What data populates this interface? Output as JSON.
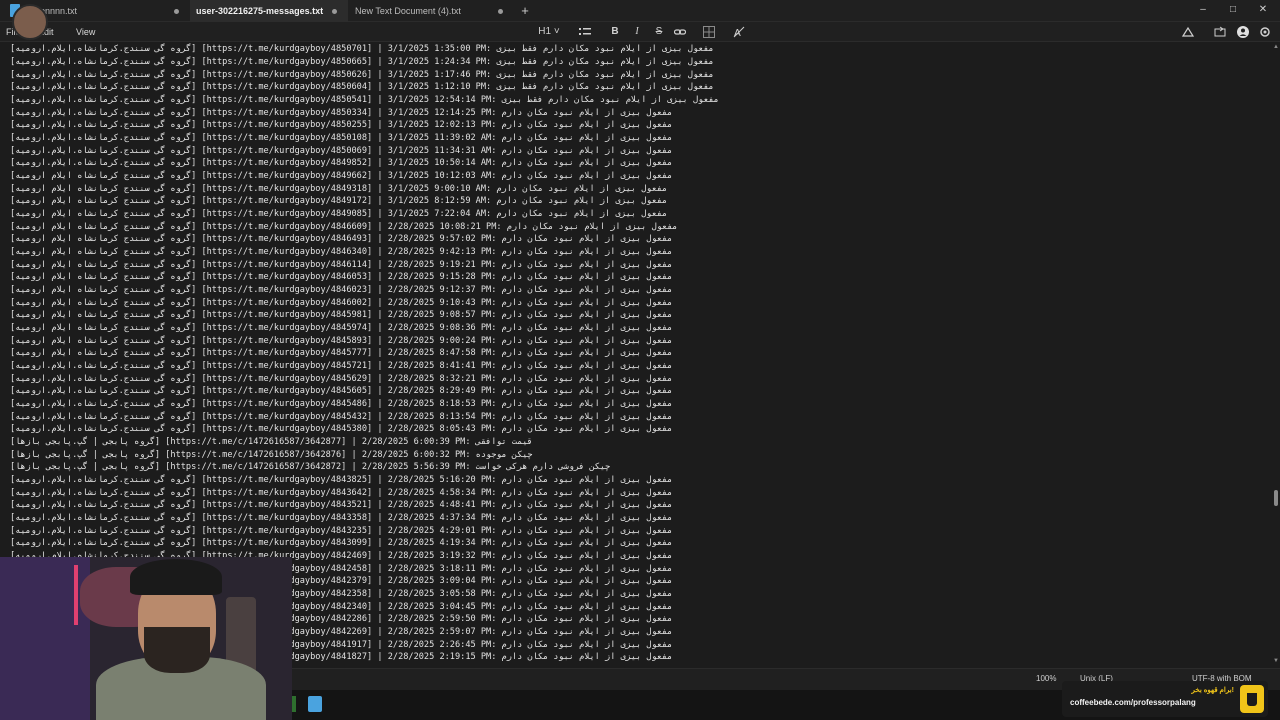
{
  "tabs": [
    {
      "label": "onnnn.txt",
      "active": false
    },
    {
      "label": "user-302216275-messages.txt",
      "active": true
    },
    {
      "label": "New Text Document (4).txt",
      "active": false
    }
  ],
  "menu": {
    "file": "File",
    "edit": "Edit",
    "view": "View"
  },
  "toolbar": {
    "heading": "H1",
    "bold": "B",
    "italic": "I",
    "strike": "S"
  },
  "lines": [
    "[گروه گی سنندج.کرمانشاه.ایلام.ارومیه] [https://t.me/kurdgayboy/4850701] | 3/1/2025 1:35:00 PM: مفعول بیزی از ایلام نبود مکان دارم فقط بیزی",
    "[گروه گی سنندج.کرمانشاه.ایلام.ارومیه] [https://t.me/kurdgayboy/4850665] | 3/1/2025 1:24:34 PM: مفعول بیزی از ایلام نبود مکان دارم فقط بیزی",
    "[گروه گی سنندج.کرمانشاه.ایلام.ارومیه] [https://t.me/kurdgayboy/4850626] | 3/1/2025 1:17:46 PM: مفعول بیزی از ایلام نبود مکان دارم فقط بیزی",
    "[گروه گی سنندج.کرمانشاه.ایلام.ارومیه] [https://t.me/kurdgayboy/4850604] | 3/1/2025 1:12:10 PM: مفعول بیزی از ایلام نبود مکان دارم فقط بیزی",
    "[گروه گی سنندج.کرمانشاه.ایلام.ارومیه] [https://t.me/kurdgayboy/4850541] | 3/1/2025 12:54:14 PM: مفعول بیزی از ایلام نبود مکان دارم فقط بیزی",
    "[گروه گی سنندج.کرمانشاه.ایلام.ارومیه] [https://t.me/kurdgayboy/4850334] | 3/1/2025 12:14:25 PM: مفعول بیزی از ایلام نبود مکان دارم",
    "[گروه گی سنندج.کرمانشاه.ایلام.ارومیه] [https://t.me/kurdgayboy/4850255] | 3/1/2025 12:02:13 PM: مفعول بیزی از ایلام نبود مکان دارم",
    "[گروه گی سنندج.کرمانشاه.ایلام.ارومیه] [https://t.me/kurdgayboy/4850108] | 3/1/2025 11:39:02 AM: مفعول بیزی از ایلام نبود مکان دارم",
    "[گروه گی سنندج.کرمانشاه.ایلام.ارومیه] [https://t.me/kurdgayboy/4850069] | 3/1/2025 11:34:31 AM: مفعول بیزی از ایلام نبود مکان دارم",
    "[گروه گی سنندج.کرمانشاه.ایلام.ارومیه] [https://t.me/kurdgayboy/4849852] | 3/1/2025 10:50:14 AM: مفعول بیزی از ایلام نبود مکان دارم",
    "[گروه گی سنندج کرمانشاه ایلام ارومیه] [https://t.me/kurdgayboy/4849662] | 3/1/2025 10:12:03 AM: مفعول بیزی از ایلام نبود مکان دارم",
    "[گروه گی سنندج کرمانشاه ایلام ارومیه] [https://t.me/kurdgayboy/4849318] | 3/1/2025 9:00:10 AM: مفعول بیزی از ایلام نبود مکان دارم",
    "[گروه گی سنندج کرمانشاه ایلام ارومیه] [https://t.me/kurdgayboy/4849172] | 3/1/2025 8:12:59 AM: مفعول بیزی از ایلام نبود مکان دارم",
    "[گروه گی سنندج کرمانشاه ایلام ارومیه] [https://t.me/kurdgayboy/4849085] | 3/1/2025 7:22:04 AM: مفعول بیزی از ایلام نبود مکان دارم",
    "[گروه گی سنندج کرمانشاه ایلام ارومیه] [https://t.me/kurdgayboy/4846609] | 2/28/2025 10:08:21 PM: مفعول بیزی از ایلام نبود مکان دارم",
    "[گروه گی سنندج کرمانشاه ایلام ارومیه] [https://t.me/kurdgayboy/4846493] | 2/28/2025 9:57:02 PM: مفعول بیزی از ایلام نبود مکان دارم",
    "[گروه گی سنندج کرمانشاه ایلام ارومیه] [https://t.me/kurdgayboy/4846340] | 2/28/2025 9:42:13 PM: مفعول بیزی از ایلام نبود مکان دارم",
    "[گروه گی سنندج کرمانشاه ایلام ارومیه] [https://t.me/kurdgayboy/4846114] | 2/28/2025 9:19:21 PM: مفعول بیزی از ایلام نبود مکان دارم",
    "[گروه گی سنندج کرمانشاه ایلام ارومیه] [https://t.me/kurdgayboy/4846053] | 2/28/2025 9:15:28 PM: مفعول بیزی از ایلام نبود مکان دارم",
    "[گروه گی سنندج کرمانشاه ایلام ارومیه] [https://t.me/kurdgayboy/4846023] | 2/28/2025 9:12:37 PM: مفعول بیزی از ایلام نبود مکان دارم",
    "[گروه گی سنندج کرمانشاه ایلام ارومیه] [https://t.me/kurdgayboy/4846002] | 2/28/2025 9:10:43 PM: مفعول بیزی از ایلام نبود مکان دارم",
    "[گروه گی سنندج کرمانشاه ایلام ارومیه] [https://t.me/kurdgayboy/4845981] | 2/28/2025 9:08:57 PM: مفعول بیزی از ایلام نبود مکان دارم",
    "[گروه گی سنندج کرمانشاه ایلام ارومیه] [https://t.me/kurdgayboy/4845974] | 2/28/2025 9:08:36 PM: مفعول بیزی از ایلام نبود مکان دارم",
    "[گروه گی سنندج کرمانشاه ایلام ارومیه] [https://t.me/kurdgayboy/4845893] | 2/28/2025 9:00:24 PM: مفعول بیزی از ایلام نبود مکان دارم",
    "[گروه گی سنندج کرمانشاه ایلام ارومیه] [https://t.me/kurdgayboy/4845777] | 2/28/2025 8:47:58 PM: مفعول بیزی از ایلام نبود مکان دارم",
    "[گروه گی سنندج.کرمانشاه.ایلام.ارومیه] [https://t.me/kurdgayboy/4845721] | 2/28/2025 8:41:41 PM: مفعول بیزی از ایلام نبود مکان دارم",
    "[گروه گی سنندج.کرمانشاه.ایلام.ارومیه] [https://t.me/kurdgayboy/4845629] | 2/28/2025 8:32:21 PM: مفعول بیزی از ایلام نبود مکان دارم",
    "[گروه گی سنندج.کرمانشاه.ایلام.ارومیه] [https://t.me/kurdgayboy/4845605] | 2/28/2025 8:29:49 PM: مفعول بیزی از ایلام نبود مکان دارم",
    "[گروه گی سنندج.کرمانشاه.ایلام.ارومیه] [https://t.me/kurdgayboy/4845486] | 2/28/2025 8:18:53 PM: مفعول بیزی از ایلام نبود مکان دارم",
    "[گروه گی سنندج.کرمانشاه.ایلام.ارومیه] [https://t.me/kurdgayboy/4845432] | 2/28/2025 8:13:54 PM: مفعول بیزی از ایلام نبود مکان دارم",
    "[گروه گی سنندج.کرمانشاه.ایلام.ارومیه] [https://t.me/kurdgayboy/4845380] | 2/28/2025 8:05:43 PM: مفعول بیزی از ایلام نبود مکان دارم",
    "[گروه پابجی | گپ.پابجی بازها] [https://t.me/c/1472616587/3642877] | 2/28/2025 6:00:39 PM: قیمت توافقی",
    "[گروه پابجی | گپ.پابجی بازها] [https://t.me/c/1472616587/3642876] | 2/28/2025 6:00:32 PM: چیکن موجوده",
    "[گروه پابجی | گپ.پابجی بازها] [https://t.me/c/1472616587/3642872] | 2/28/2025 5:56:39 PM: چیکن فروشی دارم هرکی خواست",
    "[گروه گی سنندج.کرمانشاه.ایلام.ارومیه] [https://t.me/kurdgayboy/4843825] | 2/28/2025 5:16:20 PM: مفعول بیزی از ایلام نبود مکان دارم",
    "[گروه گی سنندج.کرمانشاه.ایلام.ارومیه] [https://t.me/kurdgayboy/4843642] | 2/28/2025 4:58:34 PM: مفعول بیزی از ایلام نبود مکان دارم",
    "[گروه گی سنندج.کرمانشاه.ایلام.ارومیه] [https://t.me/kurdgayboy/4843521] | 2/28/2025 4:48:41 PM: مفعول بیزی از ایلام نبود مکان دارم",
    "[گروه گی سنندج.کرمانشاه.ایلام.ارومیه] [https://t.me/kurdgayboy/4843358] | 2/28/2025 4:37:34 PM: مفعول بیزی از ایلام نبود مکان دارم",
    "[گروه گی سنندج.کرمانشاه.ایلام.ارومیه] [https://t.me/kurdgayboy/4843235] | 2/28/2025 4:29:01 PM: مفعول بیزی از ایلام نبود مکان دارم",
    "[گروه گی سنندج.کرمانشاه.ایلام.ارومیه] [https://t.me/kurdgayboy/4843099] | 2/28/2025 4:19:34 PM: مفعول بیزی از ایلام نبود مکان دارم",
    "[گروه گی سنندج.کرمانشاه.ایلام.ارومیه] [https://t.me/kurdgayboy/4842469] | 2/28/2025 3:19:32 PM: مفعول بیزی از ایلام نبود مکان دارم",
    "[گروه گی سنندج.کرمانشاه.ایلام.ارومیه] [https://t.me/kurdgayboy/4842458] | 2/28/2025 3:18:11 PM: مفعول بیزی از ایلام نبود مکان دارم",
    "[گروه گی سنندج.کرمانشاه.ایلام.ارومیه] [https://t.me/kurdgayboy/4842379] | 2/28/2025 3:09:04 PM: مفعول بیزی از ایلام نبود مکان دارم",
    "[گروه گی سنندج.کرمانشاه.ایلام.ارومیه] [https://t.me/kurdgayboy/4842358] | 2/28/2025 3:05:58 PM: مفعول بیزی از ایلام نبود مکان دارم",
    "[گروه گی سنندج.کرمانشاه.ایلام.ارومیه] [https://t.me/kurdgayboy/4842340] | 2/28/2025 3:04:45 PM: مفعول بیزی از ایلام نبود مکان دارم",
    "[گروه گی سنندج.کرمانشاه.ایلام.ارومیه] [https://t.me/kurdgayboy/4842286] | 2/28/2025 2:59:50 PM: مفعول بیزی از ایلام نبود مکان دارم",
    "[گروه گی سنندج.کرمانشاه.ایلام.ارومیه] [https://t.me/kurdgayboy/4842269] | 2/28/2025 2:59:07 PM: مفعول بیزی از ایلام نبود مکان دارم",
    "[گروه گی سنندج.کرمانشاه.ایلام.ارومیه] [https://t.me/kurdgayboy/4841917] | 2/28/2025 2:26:45 PM: مفعول بیزی از ایلام نبود مکان دارم",
    "[گروه گی سنندج.کرمانشاه.ایلام.ارومیه] [https://t.me/kurdgayboy/4841827] | 2/28/2025 2:19:15 PM: مفعول بیزی از ایلام نبود مکان دارم"
  ],
  "status": {
    "zoom": "100%",
    "line_ending": "Unix (LF)",
    "encoding": "UTF-8 with BOM"
  },
  "donate": {
    "title": "برام قهوه بخر!",
    "url": "coffeebede.com/professorpalang"
  },
  "colors": {
    "accent": "#4aa3df",
    "donate_accent": "#f0c419",
    "editor_bg": "#1c1c1c"
  },
  "icons": [
    "notepad-icon",
    "list-icon",
    "link-icon",
    "table-icon",
    "clear-format-icon",
    "settings-icon",
    "account-icon",
    "copilot-icon",
    "share-icon"
  ]
}
